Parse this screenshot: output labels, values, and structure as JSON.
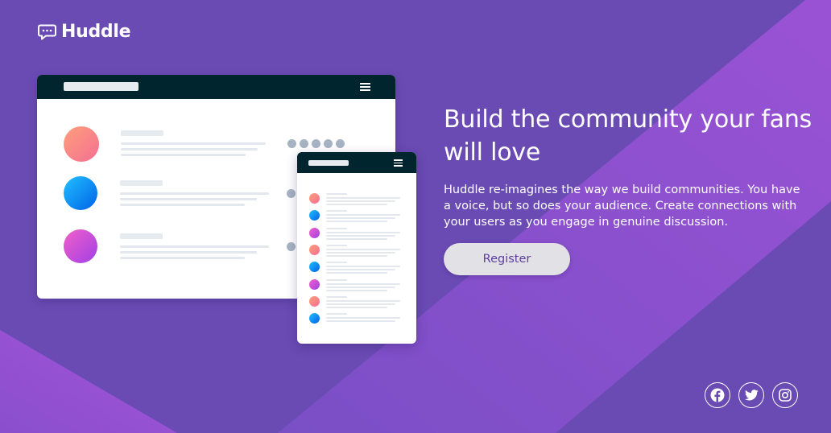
{
  "brand": {
    "name": "Huddle",
    "logo_icon": "chat-bubble-icon"
  },
  "hero": {
    "heading": "Build the community your fans will love",
    "description": "Huddle re-imagines the way we build communities. You have a voice, but so does your audience. Create connections with your users as you engage in genuine discussion.",
    "cta_label": "Register"
  },
  "illustration": {
    "desktop_rows": [
      "orange-pink",
      "blue",
      "magenta-purple"
    ],
    "mobile_rows": [
      "orange-pink",
      "blue",
      "magenta-purple",
      "orange-pink",
      "blue",
      "magenta-purple",
      "orange-pink",
      "blue"
    ]
  },
  "socials": [
    {
      "icon": "facebook-icon"
    },
    {
      "icon": "twitter-icon"
    },
    {
      "icon": "instagram-icon"
    }
  ],
  "colors": {
    "background": "#6a4bb4",
    "background_accent": "#8e4fcf",
    "button_bg": "#e2e1e6",
    "button_text": "#5c3e9e",
    "mockup_bar": "#00252e"
  }
}
